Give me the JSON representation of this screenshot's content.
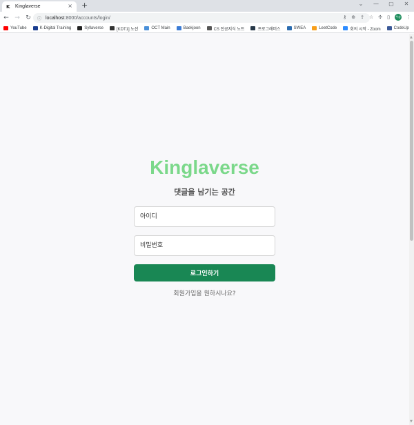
{
  "window": {
    "tab_favicon": "K",
    "tab_title": "Kinglaverse",
    "tab_close": "×",
    "new_tab": "+",
    "controls": [
      "⌄",
      "—",
      "▢",
      "✕"
    ]
  },
  "toolbar": {
    "back": "←",
    "forward": "→",
    "reload": "↻",
    "url_host": "localhost",
    "url_path": ":8000/accounts/login/",
    "profile_initials": "우성"
  },
  "bookmarks": [
    {
      "label": "YouTube",
      "icon": "youtube-icon",
      "color": "#ff0000"
    },
    {
      "label": "K-Digital Training",
      "icon": "kdt-icon",
      "color": "#1a3d8f"
    },
    {
      "label": "Syllaverse",
      "icon": "syllaverse-icon",
      "color": "#222222"
    },
    {
      "label": "[KDT1] 노션",
      "icon": "notion-icon",
      "color": "#333333"
    },
    {
      "label": "OCT Main",
      "icon": "oct-icon",
      "color": "#4a90d9"
    },
    {
      "label": "Baekjoon",
      "icon": "baekjoon-icon",
      "color": "#3a7bd5"
    },
    {
      "label": "CS 전공지식 노트",
      "icon": "book-icon",
      "color": "#555555"
    },
    {
      "label": "프로그래머스",
      "icon": "programmers-icon",
      "color": "#263747"
    },
    {
      "label": "SWEA",
      "icon": "swea-icon",
      "color": "#2b6cb0"
    },
    {
      "label": "LeetCode",
      "icon": "leetcode-icon",
      "color": "#f89f1b"
    },
    {
      "label": "회의 시작 - Zoom",
      "icon": "zoom-icon",
      "color": "#2d8cff"
    },
    {
      "label": "CodeUp",
      "icon": "codeup-icon",
      "color": "#3b5998"
    }
  ],
  "page": {
    "brand": "Kinglaverse",
    "tagline": "댓글을 남기는 공간",
    "id_placeholder": "아이디",
    "pw_placeholder": "비밀번호",
    "login_label": "로그인하기",
    "signup_text": "회원가입을 원하시나요?"
  },
  "colors": {
    "brand": "#7bd88a",
    "button": "#198754"
  }
}
